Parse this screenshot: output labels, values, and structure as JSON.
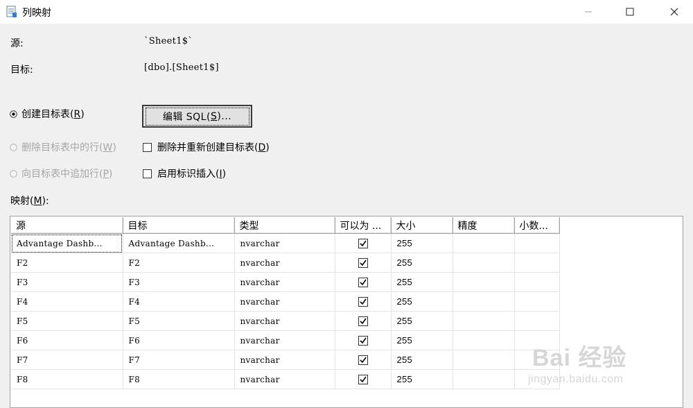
{
  "window": {
    "title": "列映射",
    "icon": "table-mapping-icon",
    "controls": [
      "minimize-icon",
      "maximize-icon",
      "close-icon"
    ]
  },
  "source": {
    "label": "源:",
    "value": "`Sheet1$`"
  },
  "target": {
    "label": "目标:",
    "value": "[dbo].[Sheet1$]"
  },
  "options": {
    "create_table": {
      "label": "创建目标表(",
      "key": "R",
      "suffix": ")",
      "selected": true,
      "enabled": true
    },
    "delete_rows": {
      "label": "删除目标表中的行(",
      "key": "W",
      "suffix": ")",
      "selected": false,
      "enabled": false
    },
    "append_rows": {
      "label": "向目标表中追加行(",
      "key": "P",
      "suffix": ")",
      "selected": false,
      "enabled": false
    },
    "edit_sql": {
      "label_pre": "编辑 SQL(",
      "key": "S",
      "label_post": ")..."
    },
    "drop_recreate": {
      "label": "删除并重新创建目标表(",
      "key": "D",
      "suffix": ")",
      "checked": false
    },
    "identity_insert": {
      "label": "启用标识插入(",
      "key": "I",
      "suffix": ")",
      "checked": false
    }
  },
  "mapping": {
    "label": "映射(",
    "key": "M",
    "suffix": "):",
    "columns": [
      "源",
      "目标",
      "类型",
      "可以为 ...",
      "大小",
      "精度",
      "小数..."
    ],
    "rows": [
      {
        "source": "Advantage Dashb...",
        "target": "Advantage Dashb...",
        "type": "nvarchar",
        "nullable": true,
        "size": "255",
        "precision": "",
        "scale": ""
      },
      {
        "source": "F2",
        "target": "F2",
        "type": "nvarchar",
        "nullable": true,
        "size": "255",
        "precision": "",
        "scale": ""
      },
      {
        "source": "F3",
        "target": "F3",
        "type": "nvarchar",
        "nullable": true,
        "size": "255",
        "precision": "",
        "scale": ""
      },
      {
        "source": "F4",
        "target": "F4",
        "type": "nvarchar",
        "nullable": true,
        "size": "255",
        "precision": "",
        "scale": ""
      },
      {
        "source": "F5",
        "target": "F5",
        "type": "nvarchar",
        "nullable": true,
        "size": "255",
        "precision": "",
        "scale": ""
      },
      {
        "source": "F6",
        "target": "F6",
        "type": "nvarchar",
        "nullable": true,
        "size": "255",
        "precision": "",
        "scale": ""
      },
      {
        "source": "F7",
        "target": "F7",
        "type": "nvarchar",
        "nullable": true,
        "size": "255",
        "precision": "",
        "scale": ""
      },
      {
        "source": "F8",
        "target": "F8",
        "type": "nvarchar",
        "nullable": true,
        "size": "255",
        "precision": "",
        "scale": ""
      }
    ]
  },
  "watermark": {
    "brand": "Bai 经验",
    "url": "jingyan.baidu.com"
  }
}
